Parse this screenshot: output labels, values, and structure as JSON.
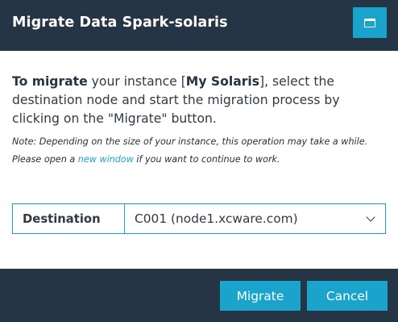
{
  "dialog": {
    "title": "Migrate Data Spark-solaris",
    "maximize_icon": "window-maximize-icon"
  },
  "message": {
    "lead": "To migrate",
    "part1": " your instance [",
    "instance": "My Solaris",
    "part2": "], select the destination node and start the migration process by clicking on the \"Migrate\" button."
  },
  "note": {
    "before": "Note: Depending on the size of your instance, this operation may take a while. Please open a ",
    "link": "new window",
    "after": " if you want to continue to work."
  },
  "destination": {
    "label": "Destination",
    "selected": "C001 (node1.xcware.com)",
    "chevron_icon": "chevron-down-icon"
  },
  "footer": {
    "migrate_label": "Migrate",
    "cancel_label": "Cancel"
  },
  "colors": {
    "header_bg": "#253545",
    "accent": "#1aa4cc"
  }
}
